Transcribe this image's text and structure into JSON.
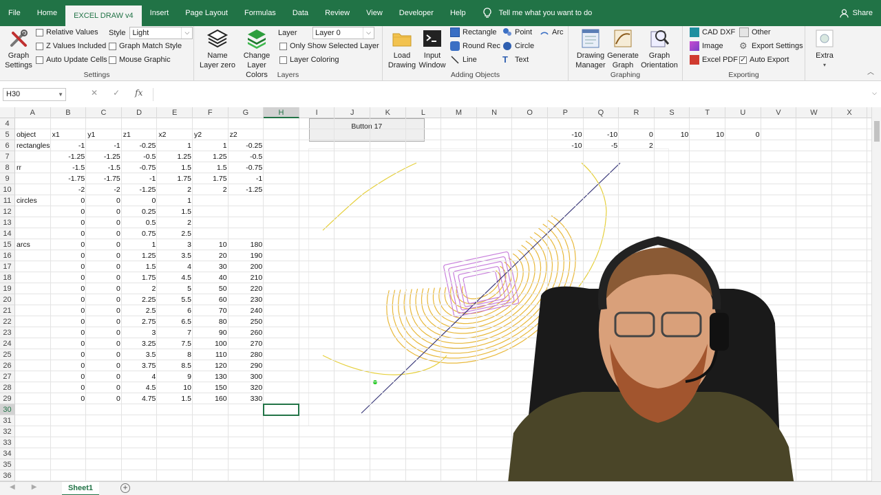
{
  "menubar": {
    "tabs": [
      "File",
      "Home",
      "EXCEL DRAW v4",
      "Insert",
      "Page Layout",
      "Formulas",
      "Data",
      "Review",
      "View",
      "Developer",
      "Help"
    ],
    "active_tab": "EXCEL DRAW v4",
    "tell_me": "Tell me what you want to do",
    "share": "Share"
  },
  "ribbon": {
    "settings": {
      "graph_settings": "Graph Settings",
      "relative_values": "Relative Values",
      "z_values_included": "Z Values Included",
      "auto_update_cells": "Auto Update Cells",
      "style_label": "Style",
      "style_value": "Light",
      "graph_match_style": "Graph Match Style",
      "mouse_graphic": "Mouse Graphic",
      "label": "Settings"
    },
    "layers": {
      "name_layer_zero": "Name Layer zero",
      "change_layer_colors": "Change Layer Colors",
      "layer_label": "Layer",
      "layer_value": "Layer 0",
      "only_show_selected": "Only Show Selected Layer",
      "layer_coloring": "Layer Coloring",
      "label": "Layers"
    },
    "adding": {
      "load_drawing": "Load Drawing",
      "input_window": "Input Window",
      "rectangle": "Rectangle",
      "round_rec": "Round Rec",
      "line": "Line",
      "point": "Point",
      "circle": "Circle",
      "text": "Text",
      "arc": "Arc",
      "label": "Adding Objects"
    },
    "graphing": {
      "drawing_manager": "Drawing Manager",
      "generate_graph": "Generate Graph",
      "graph_orientation": "Graph Orientation",
      "label": "Graphing"
    },
    "exporting": {
      "cad_dxf": "CAD DXF",
      "image": "Image",
      "excel_pdf": "Excel PDF",
      "other": "Other",
      "export_settings": "Export Settings",
      "auto_export": "Auto Export",
      "label": "Exporting"
    },
    "extra": "Extra"
  },
  "formula_bar": {
    "name_box": "H30",
    "fx": "fx",
    "content": ""
  },
  "columns": [
    "A",
    "B",
    "C",
    "D",
    "E",
    "F",
    "G",
    "H",
    "I",
    "J",
    "K",
    "L",
    "M",
    "N",
    "O",
    "P",
    "Q",
    "R",
    "S",
    "T",
    "U",
    "V",
    "W",
    "X"
  ],
  "selected_column": "H",
  "rows_visible": [
    4,
    5,
    6,
    7,
    8,
    9,
    10,
    11,
    12,
    13,
    14,
    15,
    16,
    17,
    18,
    19,
    20,
    21,
    22,
    23,
    24,
    25,
    26,
    27,
    28,
    29,
    30,
    31,
    32,
    33,
    34,
    35,
    36
  ],
  "selected_row": 30,
  "table": [
    {
      "row": 5,
      "A": "object",
      "B": "x1",
      "C": "y1",
      "D": "z1",
      "E": "x2",
      "F": "y2",
      "G": "z2"
    },
    {
      "row": 6,
      "A": "rectangles",
      "B": "-1",
      "C": "-1",
      "D": "-0.25",
      "E": "1",
      "F": "1",
      "G": "-0.25"
    },
    {
      "row": 7,
      "A": "",
      "B": "-1.25",
      "C": "-1.25",
      "D": "-0.5",
      "E": "1.25",
      "F": "1.25",
      "G": "-0.5"
    },
    {
      "row": 8,
      "A": "rr",
      "B": "-1.5",
      "C": "-1.5",
      "D": "-0.75",
      "E": "1.5",
      "F": "1.5",
      "G": "-0.75"
    },
    {
      "row": 9,
      "A": "",
      "B": "-1.75",
      "C": "-1.75",
      "D": "-1",
      "E": "1.75",
      "F": "1.75",
      "G": "-1"
    },
    {
      "row": 10,
      "A": "",
      "B": "-2",
      "C": "-2",
      "D": "-1.25",
      "E": "2",
      "F": "2",
      "G": "-1.25"
    },
    {
      "row": 11,
      "A": "circles",
      "B": "0",
      "C": "0",
      "D": "0",
      "E": "1",
      "F": "",
      "G": ""
    },
    {
      "row": 12,
      "A": "",
      "B": "0",
      "C": "0",
      "D": "0.25",
      "E": "1.5",
      "F": "",
      "G": ""
    },
    {
      "row": 13,
      "A": "",
      "B": "0",
      "C": "0",
      "D": "0.5",
      "E": "2",
      "F": "",
      "G": ""
    },
    {
      "row": 14,
      "A": "",
      "B": "0",
      "C": "0",
      "D": "0.75",
      "E": "2.5",
      "F": "",
      "G": ""
    },
    {
      "row": 15,
      "A": "arcs",
      "B": "0",
      "C": "0",
      "D": "1",
      "E": "3",
      "F": "10",
      "G": "180"
    },
    {
      "row": 16,
      "A": "",
      "B": "0",
      "C": "0",
      "D": "1.25",
      "E": "3.5",
      "F": "20",
      "G": "190"
    },
    {
      "row": 17,
      "A": "",
      "B": "0",
      "C": "0",
      "D": "1.5",
      "E": "4",
      "F": "30",
      "G": "200"
    },
    {
      "row": 18,
      "A": "",
      "B": "0",
      "C": "0",
      "D": "1.75",
      "E": "4.5",
      "F": "40",
      "G": "210"
    },
    {
      "row": 19,
      "A": "",
      "B": "0",
      "C": "0",
      "D": "2",
      "E": "5",
      "F": "50",
      "G": "220"
    },
    {
      "row": 20,
      "A": "",
      "B": "0",
      "C": "0",
      "D": "2.25",
      "E": "5.5",
      "F": "60",
      "G": "230"
    },
    {
      "row": 21,
      "A": "",
      "B": "0",
      "C": "0",
      "D": "2.5",
      "E": "6",
      "F": "70",
      "G": "240"
    },
    {
      "row": 22,
      "A": "",
      "B": "0",
      "C": "0",
      "D": "2.75",
      "E": "6.5",
      "F": "80",
      "G": "250"
    },
    {
      "row": 23,
      "A": "",
      "B": "0",
      "C": "0",
      "D": "3",
      "E": "7",
      "F": "90",
      "G": "260"
    },
    {
      "row": 24,
      "A": "",
      "B": "0",
      "C": "0",
      "D": "3.25",
      "E": "7.5",
      "F": "100",
      "G": "270"
    },
    {
      "row": 25,
      "A": "",
      "B": "0",
      "C": "0",
      "D": "3.5",
      "E": "8",
      "F": "110",
      "G": "280"
    },
    {
      "row": 26,
      "A": "",
      "B": "0",
      "C": "0",
      "D": "3.75",
      "E": "8.5",
      "F": "120",
      "G": "290"
    },
    {
      "row": 27,
      "A": "",
      "B": "0",
      "C": "0",
      "D": "4",
      "E": "9",
      "F": "130",
      "G": "300"
    },
    {
      "row": 28,
      "A": "",
      "B": "0",
      "C": "0",
      "D": "4.5",
      "E": "10",
      "F": "150",
      "G": "320"
    },
    {
      "row": 29,
      "A": "",
      "B": "0",
      "C": "0",
      "D": "4.75",
      "E": "1.5",
      "F": "160",
      "G": "330"
    }
  ],
  "side_table": [
    {
      "row": 5,
      "P": "-10",
      "Q": "-10",
      "R": "0",
      "S": "10",
      "T": "10",
      "U": "0"
    },
    {
      "row": 6,
      "P": "-10",
      "Q": "-5",
      "R": "2",
      "S": "",
      "T": "",
      "U": ""
    }
  ],
  "button17": "Button 17",
  "sheet_tab": "Sheet1",
  "colors": {
    "excel_green": "#217346",
    "arc_gold": "#e8b83a",
    "rect_purple": "#c77ddb",
    "line_navy": "#3b3a7a",
    "point_green": "#22cc22"
  }
}
